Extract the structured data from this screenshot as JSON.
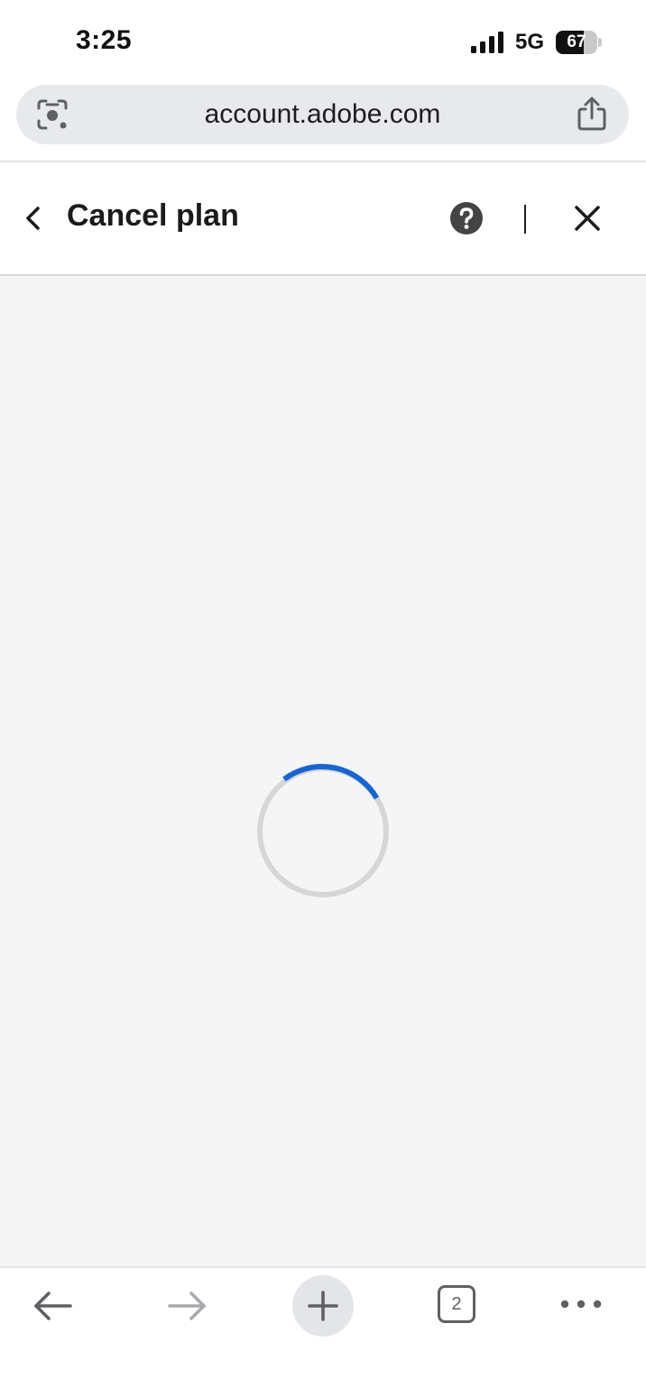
{
  "status_bar": {
    "time": "3:25",
    "network": "5G",
    "battery_percent": "67",
    "battery_level": 0.67,
    "icons": [
      "signal-icon",
      "battery-icon"
    ]
  },
  "browser": {
    "address": "account.adobe.com",
    "icons": [
      "lens-icon",
      "share-icon"
    ]
  },
  "header": {
    "title": "Cancel plan",
    "icons": [
      "back-chevron-icon",
      "help-icon",
      "close-icon"
    ]
  },
  "content": {
    "state": "loading",
    "spinner_color": "#1565d8",
    "spinner_track_color": "#d6d6d6"
  },
  "toolbar": {
    "tab_count": "2",
    "icons": [
      "back-arrow-icon",
      "forward-arrow-icon",
      "plus-icon",
      "tabs-icon",
      "more-icon"
    ]
  },
  "colors": {
    "accent": "#1565d8",
    "header_text": "#1b1b1b",
    "content_bg": "#f5f5f6",
    "icon_gray": "#5f6064"
  }
}
